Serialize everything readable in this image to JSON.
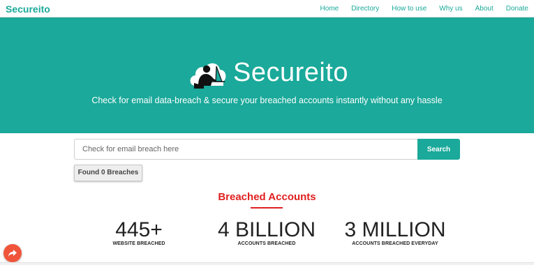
{
  "navbar": {
    "brand": "Secureito",
    "links": [
      "Home",
      "Directory",
      "How to use",
      "Why us",
      "About",
      "Donate"
    ]
  },
  "hero": {
    "title": "Secureito",
    "subtitle": "Check for email data-breach & secure your breached accounts instantly without any hassle"
  },
  "search": {
    "placeholder": "Check for email breach here",
    "value": "",
    "button_label": "Search"
  },
  "results": {
    "found_label": "Found 0 Breaches"
  },
  "breached": {
    "title": "Breached Accounts",
    "stats": [
      {
        "number": "445+",
        "label": "WEBSITE BREACHED"
      },
      {
        "number": "4 BILLION",
        "label": "ACCOUNTS BREACHED"
      },
      {
        "number": "3 MILLION",
        "label": "ACCOUNTS BREACHED EVERYDAY"
      }
    ]
  },
  "colors": {
    "accent": "#1aa99a",
    "highlight": "#e02020",
    "share_button": "#f0553b"
  },
  "icons": {
    "logo": "hacker-laptop-cloud-logo",
    "share": "share-icon"
  }
}
